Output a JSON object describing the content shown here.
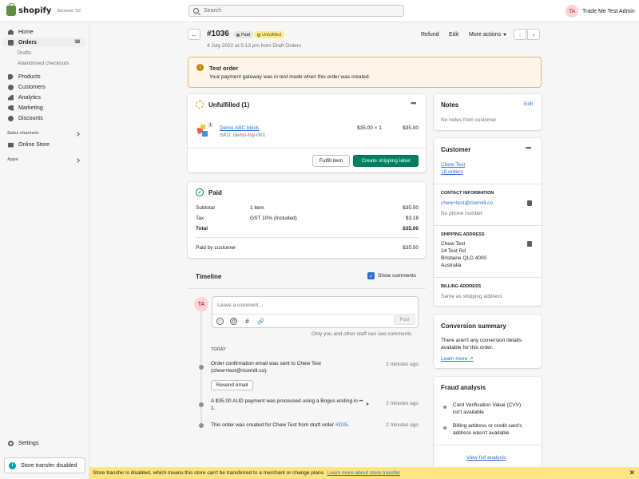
{
  "topbar": {
    "brand": "shopify",
    "edition": "Summer '22",
    "search_placeholder": "Search",
    "user_initials": "TA",
    "user_name": "Trade Me Test Admin"
  },
  "sidebar": {
    "items": [
      {
        "label": "Home",
        "icon": "home-icon"
      },
      {
        "label": "Orders",
        "icon": "orders-icon",
        "count": "18"
      },
      {
        "label": "Drafts"
      },
      {
        "label": "Abandoned checkouts"
      },
      {
        "label": "Products",
        "icon": "tag-icon"
      },
      {
        "label": "Customers",
        "icon": "person-icon"
      },
      {
        "label": "Analytics",
        "icon": "bar-chart-icon"
      },
      {
        "label": "Marketing",
        "icon": "megaphone-icon"
      },
      {
        "label": "Discounts",
        "icon": "discount-icon"
      }
    ],
    "sales_channels_label": "Sales channels",
    "online_store": "Online Store",
    "apps_label": "Apps",
    "settings": "Settings",
    "store_transfer": "Store transfer disabled"
  },
  "header": {
    "order_number": "#1036",
    "paid_badge": "Paid",
    "unfulfilled_badge": "Unfulfilled",
    "subtitle": "4 July 2022 at 5:13 pm from Draft Orders",
    "refund": "Refund",
    "edit": "Edit",
    "more_actions": "More actions"
  },
  "banner": {
    "title": "Test order",
    "text": "Your payment gateway was in test mode when this order was created."
  },
  "unfulfilled": {
    "title": "Unfulfilled (1)",
    "qty": "1",
    "product_name": "Demo ABC block",
    "sku": "SKU: demo-toy-001",
    "unit_price": "$35.00 × 1",
    "line_total": "$35.00",
    "fulfill_btn": "Fulfill item",
    "shipping_btn": "Create shipping label"
  },
  "paid": {
    "title": "Paid",
    "rows": [
      {
        "label": "Subtotal",
        "detail": "1 item",
        "amount": "$35.00"
      },
      {
        "label": "Tax",
        "detail": "GST 10% (Included)",
        "amount": "$3.18"
      },
      {
        "label": "Total",
        "detail": "",
        "amount": "$35.00"
      }
    ],
    "paid_by_label": "Paid by customer",
    "paid_by_amount": "$35.00"
  },
  "timeline": {
    "title": "Timeline",
    "show_comments": "Show comments",
    "avatar": "TA",
    "comment_placeholder": "Leave a comment...",
    "post": "Post",
    "staff_note": "Only you and other staff can see comments",
    "today": "TODAY",
    "events": [
      {
        "text": "Order confirmation email was sent to Chew Test (chew+test@ricemill.co).",
        "time": "2 minutes ago",
        "button": "Resend email"
      },
      {
        "text": "A $35.00 AUD payment was processed using a Bogus ending in •• 1.",
        "time": "2 minutes ago"
      },
      {
        "text_prefix": "This order was created for Chew Test from draft order ",
        "link": "#D35",
        "text_suffix": ".",
        "time": "2 minutes ago"
      }
    ]
  },
  "notes": {
    "title": "Notes",
    "edit": "Edit",
    "empty": "No notes from customer"
  },
  "customer": {
    "title": "Customer",
    "name": "Chew Test",
    "orders": "18 orders",
    "contact_label": "CONTACT INFORMATION",
    "email": "chew+test@ricemill.co",
    "phone": "No phone number",
    "shipping_label": "SHIPPING ADDRESS",
    "address": [
      "Chew Test",
      "24 Test Rd",
      "Brisbane QLD 4000",
      "Australia"
    ],
    "billing_label": "BILLING ADDRESS",
    "billing_same": "Same as shipping address"
  },
  "conversion": {
    "title": "Conversion summary",
    "text_line1": "There aren't any conversion details",
    "text_line2": "available for this order.",
    "learn_more": "Learn more"
  },
  "fraud": {
    "title": "Fraud analysis",
    "items": [
      {
        "line1": "Card Verification Value (CVV)",
        "line2": "isn't available"
      },
      {
        "line1": "Billing address or credit card's",
        "line2": "address wasn't available"
      }
    ],
    "view_full": "View full analysis"
  },
  "bottom_bar": {
    "text": "Store transfer is disabled, which means this store can't be transferred to a merchant or change plans.",
    "link": "Learn more about store transfer"
  },
  "colors": {
    "primary": "#008060",
    "link": "#2c6ecb",
    "warning_bg": "#fff5ea",
    "unfulfilled_badge": "#ffea8a",
    "bottom_bar": "#ffe482"
  }
}
